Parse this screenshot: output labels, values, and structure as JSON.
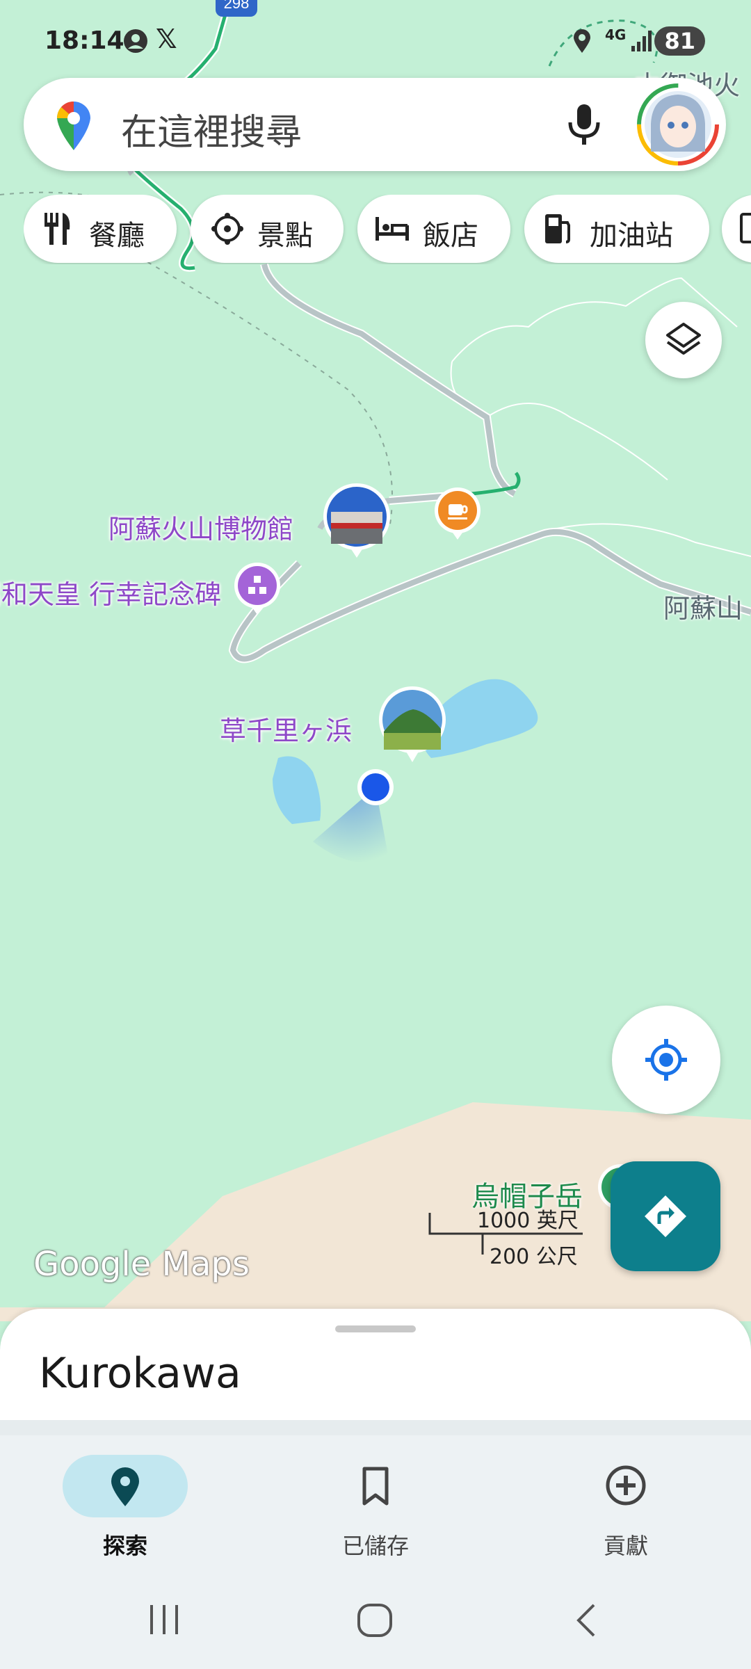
{
  "status_bar": {
    "time": "18:14",
    "network": "4G",
    "battery": "81"
  },
  "search": {
    "placeholder": "在這裡搜尋"
  },
  "chips": [
    {
      "label": "餐廳",
      "icon": "restaurant-icon"
    },
    {
      "label": "景點",
      "icon": "attraction-icon"
    },
    {
      "label": "飯店",
      "icon": "hotel-icon"
    },
    {
      "label": "加油站",
      "icon": "gas-station-icon"
    }
  ],
  "map": {
    "route_badge": "298",
    "labels": {
      "museum": "阿蘇火山博物館",
      "monument": "昭和天皇 行幸記念碑",
      "meadow": "草千里ヶ浜",
      "mountain": "烏帽子岳",
      "aso": "阿蘇山",
      "top_right": "本御池火"
    },
    "scale": {
      "imperial": "1000 英尺",
      "metric": "200 公尺"
    },
    "watermark": "Google Maps",
    "colors": {
      "land": "#c3f0d6",
      "water": "#8fd4ef",
      "road": "#b8c4c6",
      "route": "#26b06f",
      "user_dot": "#1a57e8"
    }
  },
  "sheet": {
    "title": "Kurokawa"
  },
  "bottom_nav": [
    {
      "label": "探索",
      "icon": "location-pin-icon",
      "active": true
    },
    {
      "label": "已儲存",
      "icon": "bookmark-icon",
      "active": false
    },
    {
      "label": "貢獻",
      "icon": "add-circle-icon",
      "active": false
    }
  ],
  "accent_color": "#0d7f8c"
}
